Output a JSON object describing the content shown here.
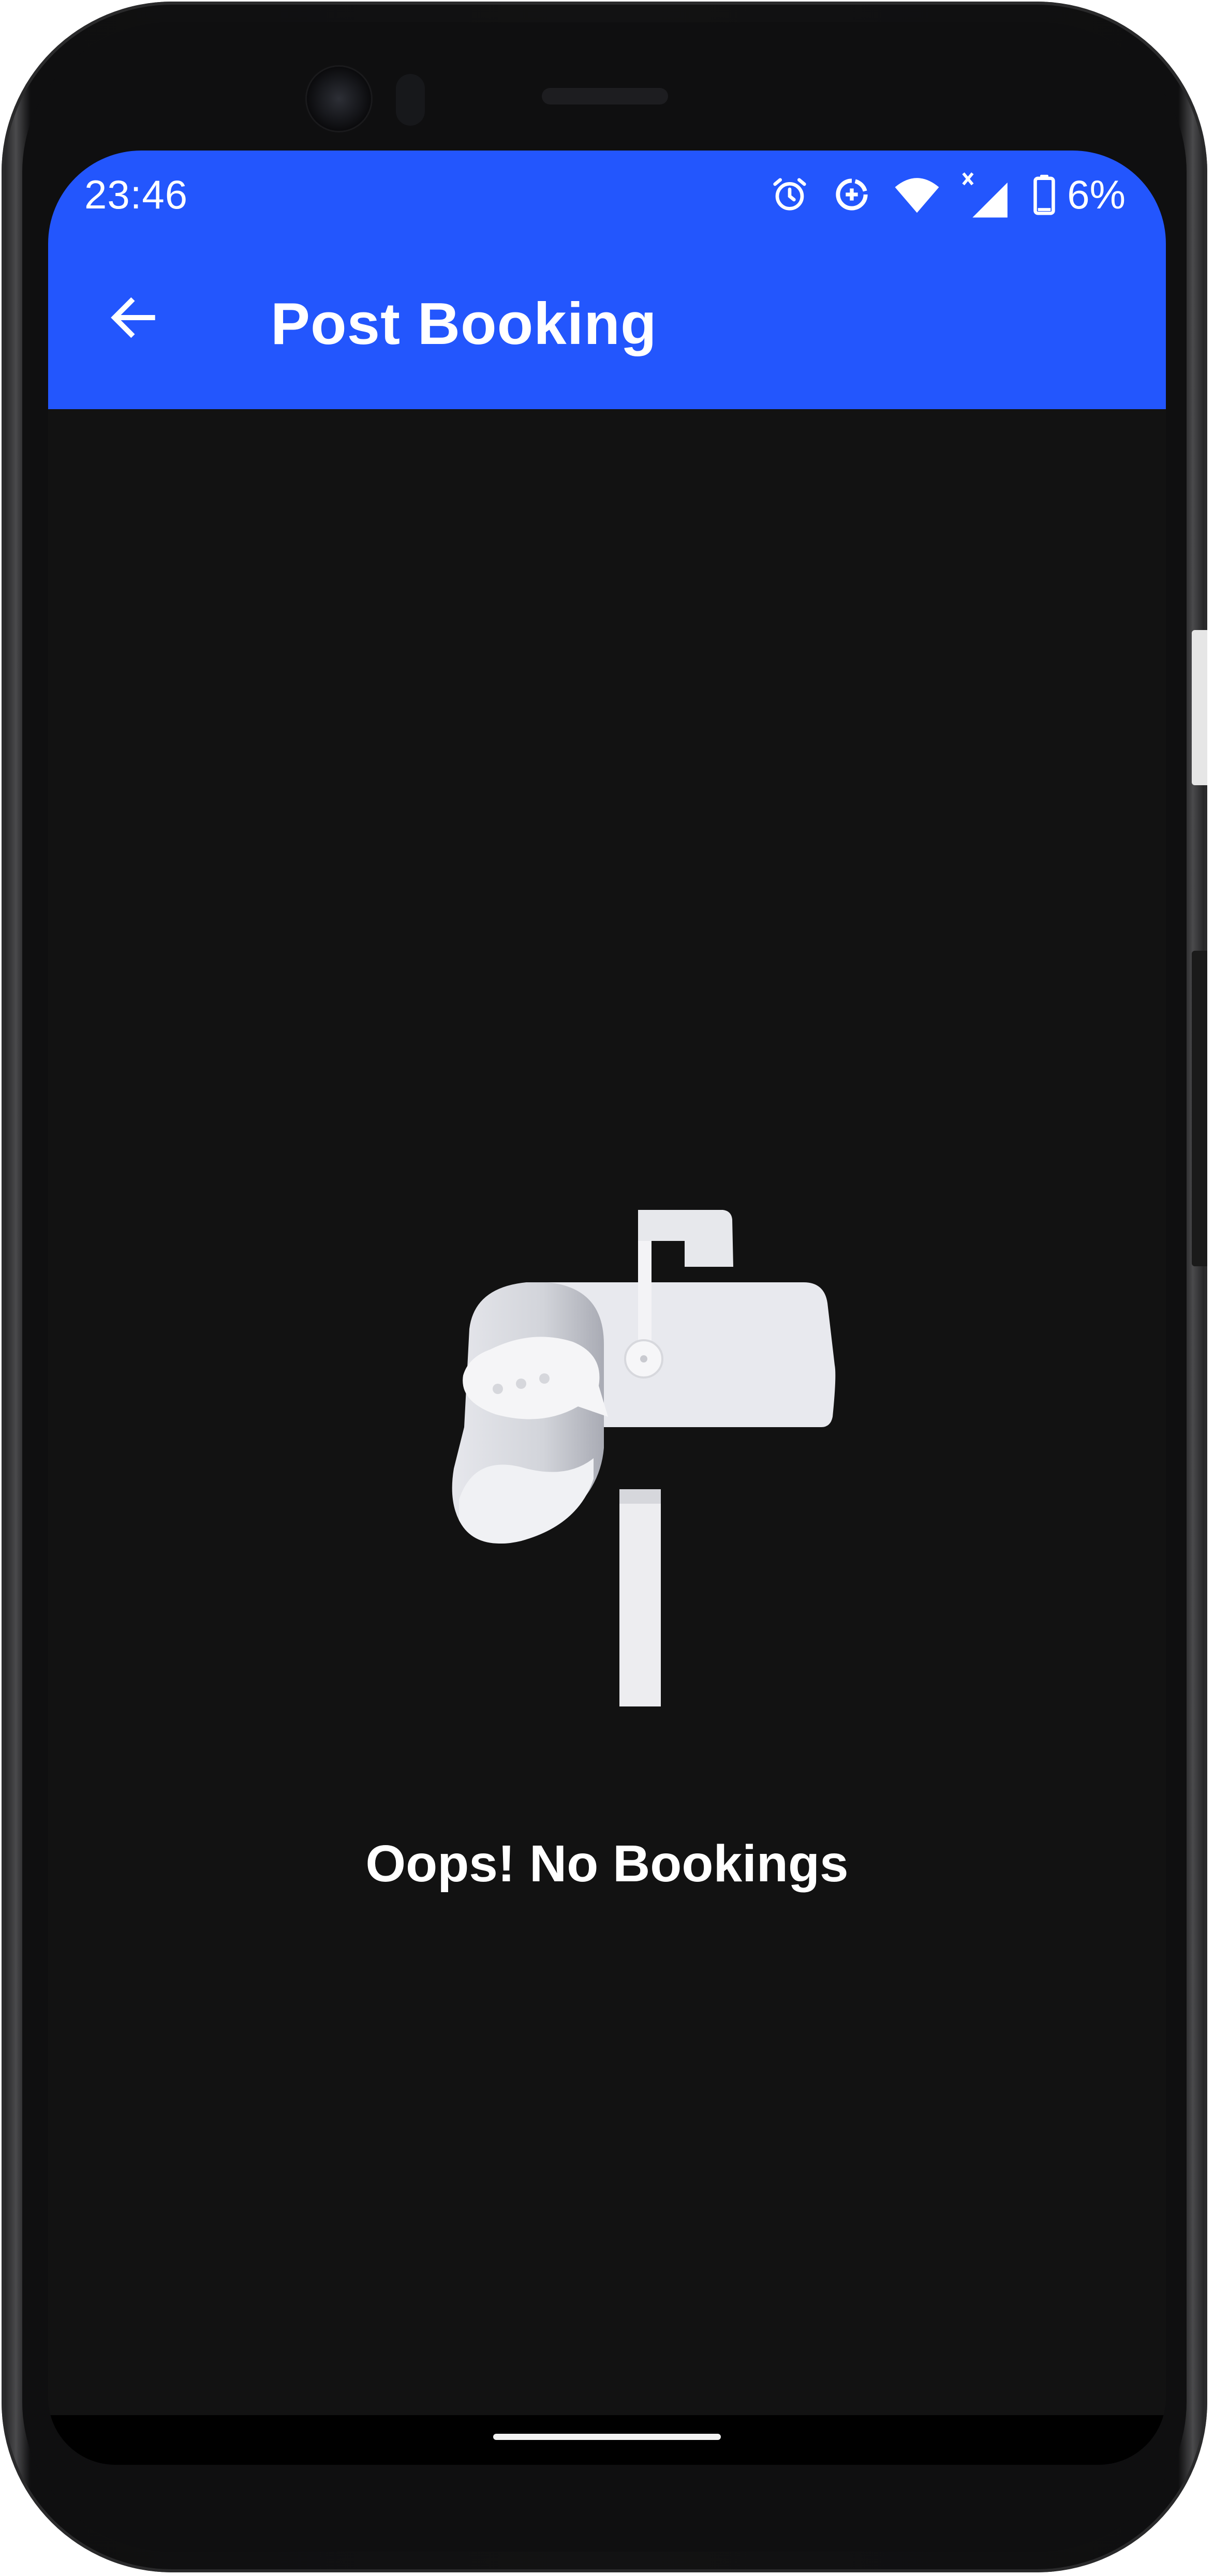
{
  "status_bar": {
    "time": "23:46",
    "battery_percent": "6%",
    "icons": [
      "alarm-icon",
      "data-saver-icon",
      "wifi-icon",
      "signal-icon",
      "battery-icon"
    ]
  },
  "app_bar": {
    "title": "Post Booking",
    "back_icon": "arrow-back-icon"
  },
  "empty_state": {
    "illustration": "mailbox-icon",
    "message": "Oops! No Bookings"
  },
  "colors": {
    "accent": "#2356fd",
    "background": "#121212",
    "text": "#ffffff"
  }
}
